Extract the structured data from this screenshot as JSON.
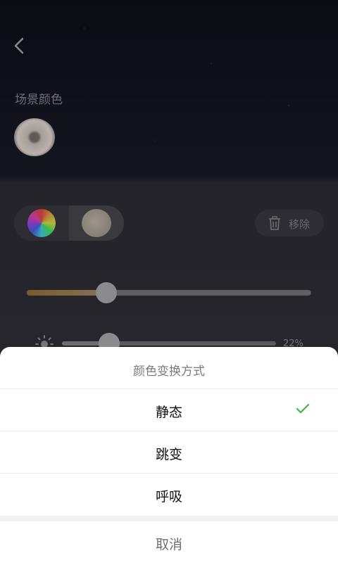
{
  "background": {
    "scene_color_label": "场景颜色",
    "remove_label": "移除",
    "color_slider_level": 0.28,
    "brightness_percent": "22%",
    "brightness_level": 0.22
  },
  "sheet": {
    "title": "颜色变换方式",
    "options": [
      {
        "label": "静态",
        "selected": true
      },
      {
        "label": "跳变",
        "selected": false
      },
      {
        "label": "呼吸",
        "selected": false
      }
    ],
    "cancel_label": "取消",
    "check_color": "#3ab54a"
  }
}
